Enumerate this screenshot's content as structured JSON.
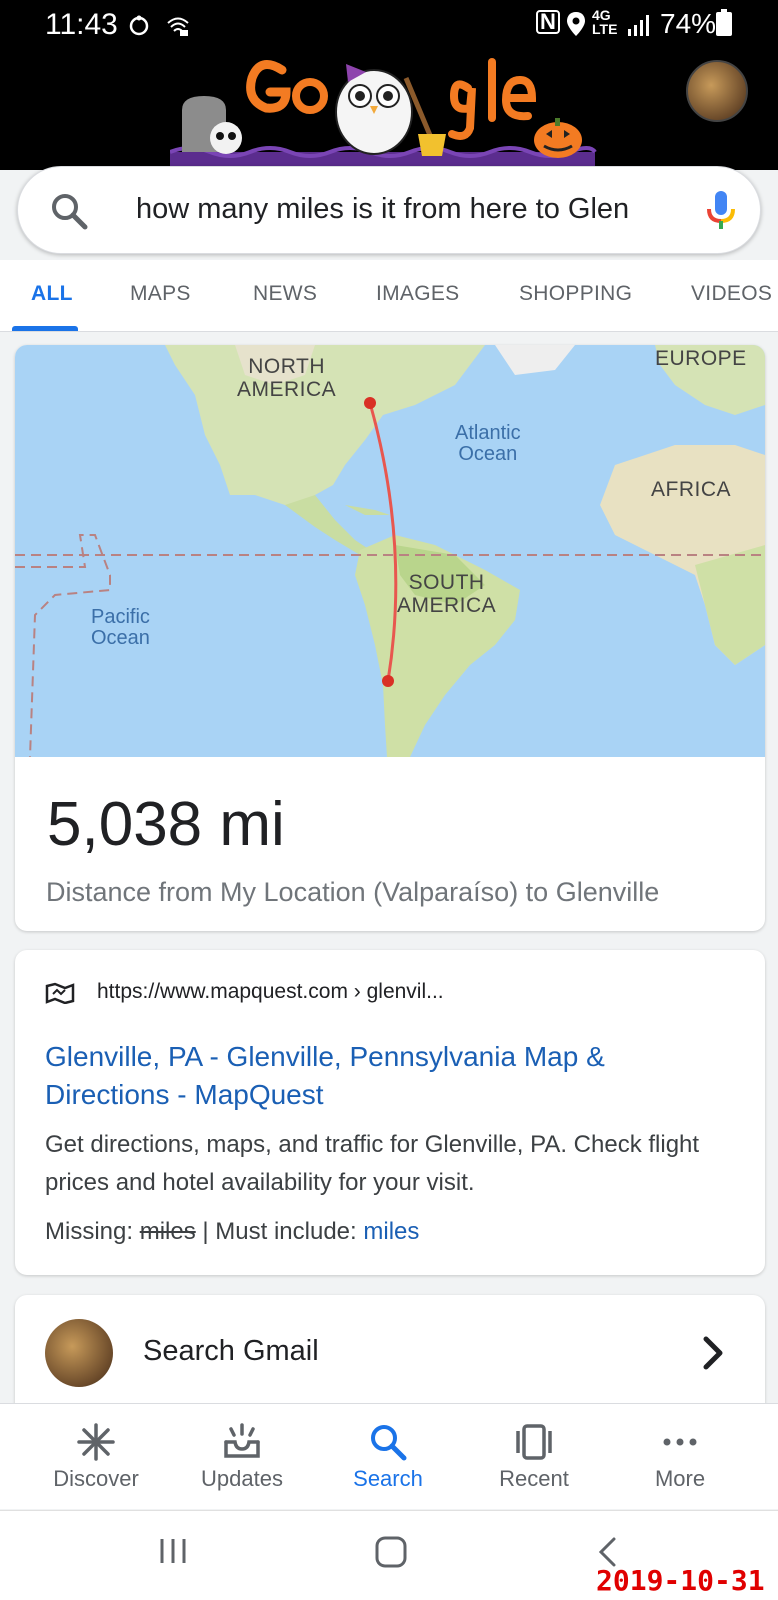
{
  "status_bar": {
    "time": "11:43",
    "network": "4G LTE",
    "battery": "74%"
  },
  "search": {
    "query": "how many miles is it from here to Glen"
  },
  "tabs": [
    {
      "label": "ALL",
      "active": true
    },
    {
      "label": "MAPS",
      "active": false
    },
    {
      "label": "NEWS",
      "active": false
    },
    {
      "label": "IMAGES",
      "active": false
    },
    {
      "label": "SHOPPING",
      "active": false
    },
    {
      "label": "VIDEOS",
      "active": false
    }
  ],
  "map": {
    "labels": {
      "north_america": "NORTH\nAMERICA",
      "europe": "EUROPE",
      "atlantic": "Atlantic\nOcean",
      "africa": "AFRICA",
      "south_america": "SOUTH\nAMERICA",
      "pacific": "Pacific\nOcean"
    },
    "route_color": "#e8574f"
  },
  "distance": {
    "value": "5,038 mi",
    "caption": "Distance from My Location (Valparaíso) to Glenville"
  },
  "result": {
    "url": "https://www.mapquest.com › glenvil...",
    "title": "Glenville, PA - Glenville, Pennsylvania Map & Directions - MapQuest",
    "snippet": "Get directions, maps, and traffic for Glenville, PA. Check flight prices and hotel availability for your visit.",
    "missing_label": "Missing:",
    "missing_term": "miles",
    "separator": "|",
    "must_include_label": "Must include:",
    "must_include_term": "miles"
  },
  "gmail": {
    "label": "Search Gmail"
  },
  "bottom_nav": [
    {
      "label": "Discover",
      "icon": "asterisk-icon",
      "active": false
    },
    {
      "label": "Updates",
      "icon": "inbox-updates-icon",
      "active": false
    },
    {
      "label": "Search",
      "icon": "search-icon",
      "active": true
    },
    {
      "label": "Recent",
      "icon": "recent-cards-icon",
      "active": false
    },
    {
      "label": "More",
      "icon": "more-dots-icon",
      "active": false
    }
  ],
  "date_stamp": "2019-10-31",
  "colors": {
    "accent": "#1a73e8",
    "link": "#1a5fb4",
    "route": "#e8574f",
    "stamp": "#e00000"
  }
}
